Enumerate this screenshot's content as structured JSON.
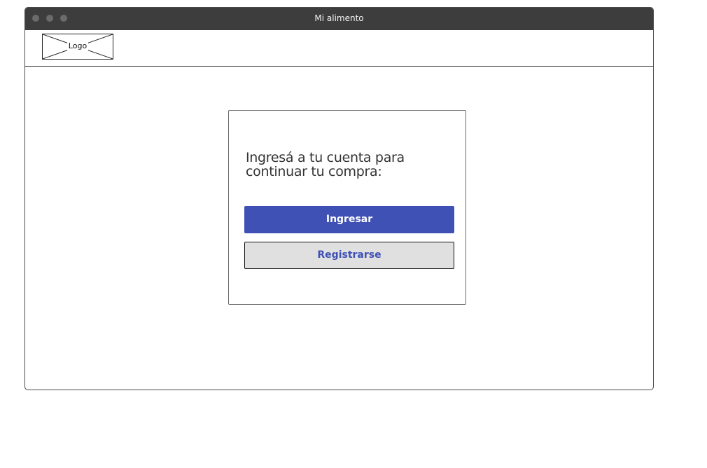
{
  "window": {
    "title": "Mi alimento"
  },
  "header": {
    "logo_label": "Logo"
  },
  "login_card": {
    "heading": "Ingresá a tu cuenta para continuar tu compra:",
    "primary_button": "Ingresar",
    "secondary_button": "Registrarse"
  },
  "colors": {
    "titlebar": "#3d3d3d",
    "primary": "#3f51b5",
    "secondary_bg": "#e0e0e0"
  }
}
